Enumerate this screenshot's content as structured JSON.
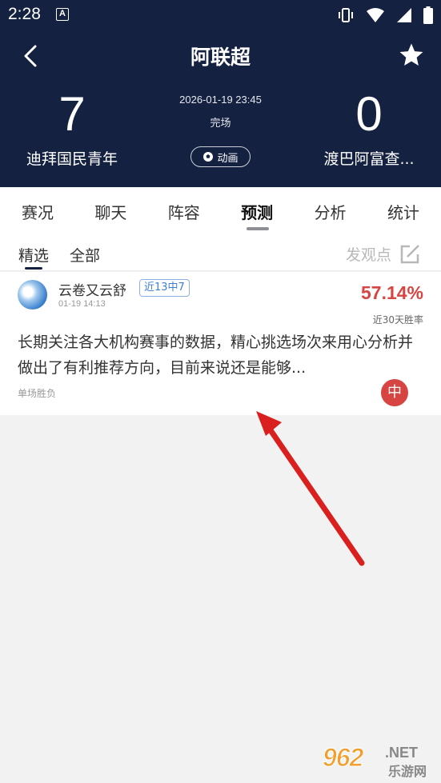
{
  "status_bar": {
    "time": "2:28",
    "a_label": "A"
  },
  "header": {
    "title": "阿联超",
    "home_team": "迪拜国民青年",
    "away_team": "渡巴阿富查...",
    "home_score": "7",
    "away_score": "0",
    "match_time": "2026-01-19 23:45",
    "match_status": "完场",
    "animation_label": "动画"
  },
  "tabs": [
    {
      "label": "赛况"
    },
    {
      "label": "聊天"
    },
    {
      "label": "阵容"
    },
    {
      "label": "预测"
    },
    {
      "label": "分析"
    },
    {
      "label": "统计"
    }
  ],
  "active_tab": "预测",
  "subtabs": {
    "featured": "精选",
    "all": "全部",
    "post_opinion": "发观点"
  },
  "post": {
    "username": "云卷又云舒",
    "streak": "近13中7",
    "time": "01-19 14:13",
    "win_rate": "57.14%",
    "win_rate_label": "近30天胜率",
    "content": "长期关注各大机构赛事的数据，精心挑选场次来用心分析并做出了有利推荐方向，目前来说还是能够...",
    "category": "单场胜负",
    "result": "中"
  },
  "watermark": {
    "number": "962",
    "domain": ".NET",
    "cn": "乐游网"
  },
  "colors": {
    "header_bg": "#142141",
    "accent_red": "#d64541",
    "arrow_red": "#d9201e"
  }
}
